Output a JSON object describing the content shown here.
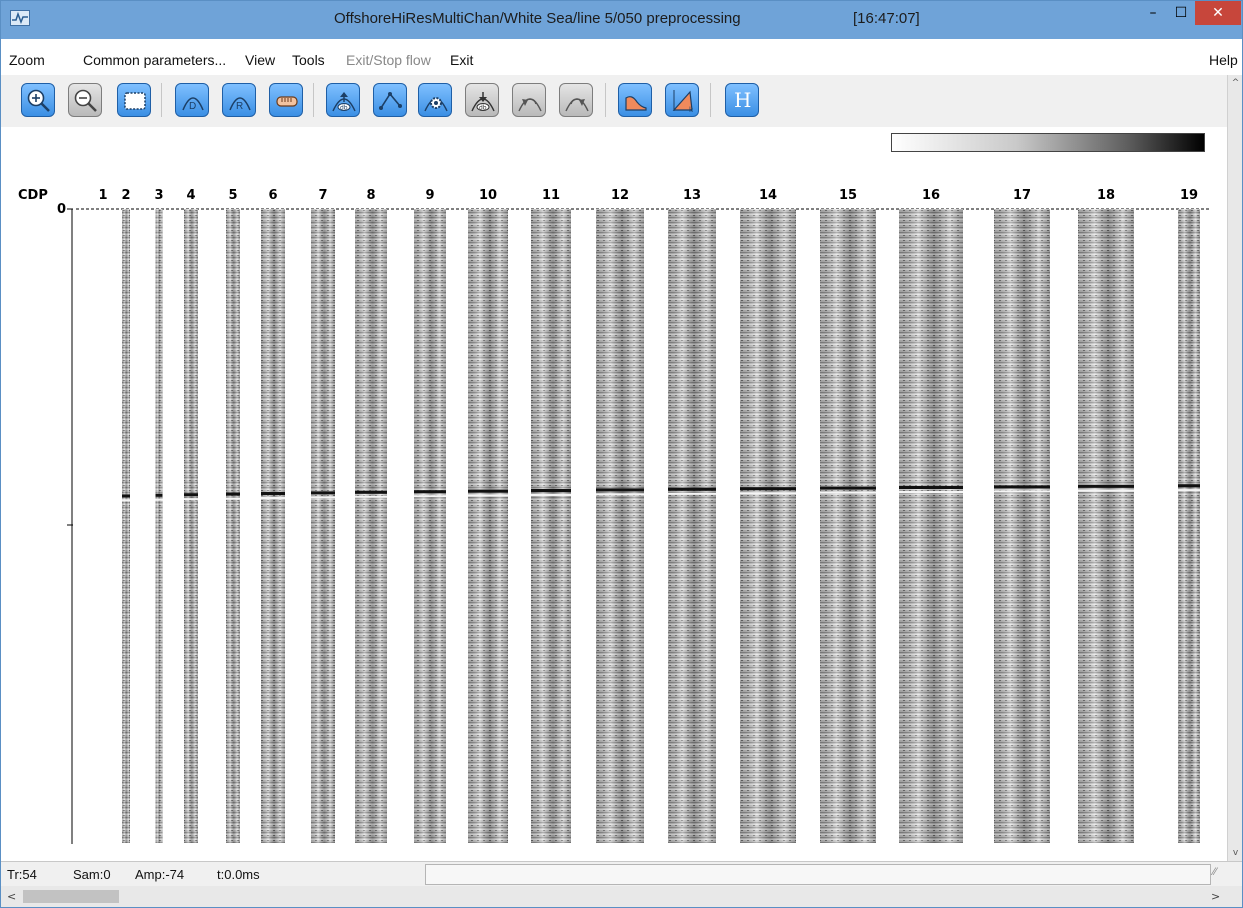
{
  "window": {
    "title": "OffshoreHiResMultiChan/White Sea/line 5/050 preprocessing",
    "time": "[16:47:07]",
    "minimize_label": "–",
    "maximize_label": "☐",
    "close_label": "✕"
  },
  "menu": {
    "zoom": "Zoom",
    "common_parameters": "Common parameters...",
    "view": "View",
    "tools": "Tools",
    "exit_stop_flow": "Exit/Stop flow",
    "exit": "Exit",
    "help": "Help"
  },
  "toolbar": {
    "icons": [
      "zoom-in-icon",
      "zoom-out-icon",
      "fit-view-icon",
      "d-curve-icon",
      "r-curve-icon",
      "gain-bar-icon",
      "gain-up-icon",
      "pick-icon",
      "settings-icon",
      "gain-down-icon",
      "undo-icon",
      "redo-icon",
      "spectrum-icon",
      "fk-icon",
      "header-icon"
    ],
    "h_label": "H"
  },
  "plot": {
    "cdp_label": "CDP",
    "cdp_numbers": [
      "1",
      "2",
      "3",
      "4",
      "5",
      "6",
      "7",
      "8",
      "9",
      "10",
      "11",
      "12",
      "13",
      "14",
      "15",
      "16",
      "17",
      "18",
      "19"
    ],
    "time_zero_label": "0"
  },
  "status": {
    "trace": "Tr:54",
    "sample": "Sam:0",
    "amplitude": "Amp:-74",
    "time": "t:0.0ms"
  },
  "scroll": {
    "up": "^",
    "down": "v",
    "left": "<",
    "right": ">"
  },
  "colors": {
    "titlebar": "#6fa3d8",
    "close": "#c7463b",
    "accent_button": "#3b8fe4"
  }
}
